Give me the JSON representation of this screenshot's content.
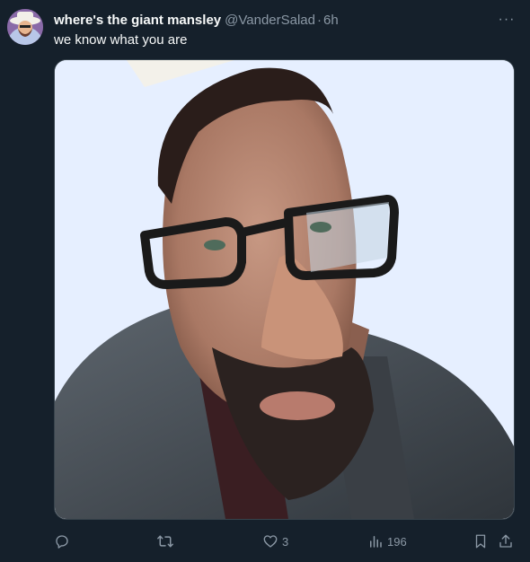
{
  "tweet": {
    "display_name": "where's the giant mansley",
    "handle": "@VanderSalad",
    "separator": "·",
    "time": "6h",
    "more_label": "···",
    "text": "we know what you are",
    "media_icon": "photo-3d-face"
  },
  "actions": {
    "reply_count": "",
    "retweet_count": "",
    "like_count": "3",
    "views_count": "196"
  },
  "colors": {
    "background": "#15202b",
    "primary_text": "#f7f9f9",
    "secondary_text": "#8b98a5",
    "border": "#38444d"
  }
}
